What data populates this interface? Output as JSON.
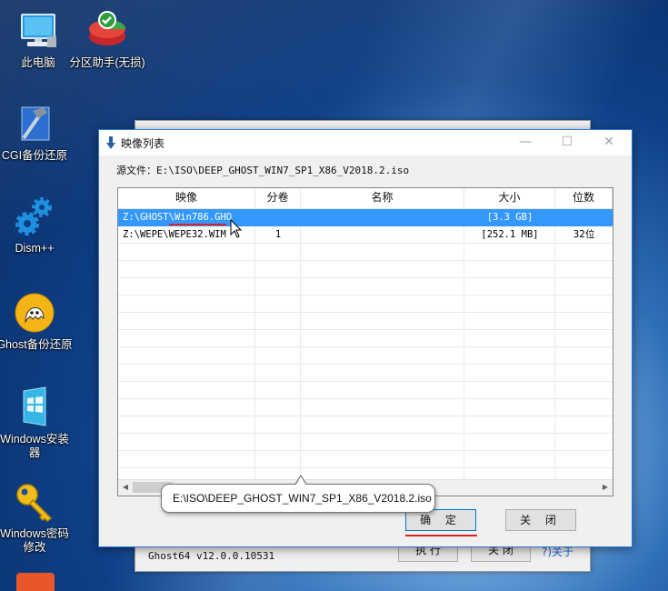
{
  "desktop": {
    "icons": [
      {
        "label": "此电脑"
      },
      {
        "label": "分区助手(无损)"
      },
      {
        "label": "CGI备份还原"
      },
      {
        "label": "Dism++"
      },
      {
        "label": "Ghost备份还原"
      },
      {
        "label": "Windows安装器"
      },
      {
        "label": "Windows密码修改"
      }
    ]
  },
  "back_window": {
    "status_text": "Ghost64 v12.0.0.10531",
    "execute_label": "执 行",
    "close_label": "关 闭",
    "about_label": "?)关于"
  },
  "dialog": {
    "title": "映像列表",
    "source_file": "源文件：E:\\ISO\\DEEP_GHOST_WIN7_SP1_X86_V2018.2.iso",
    "columns": [
      "映像",
      "分卷",
      "名称",
      "大小",
      "位数"
    ],
    "rows": [
      {
        "image": "Z:\\GHOST\\Win786.GHO",
        "volume": "",
        "name": "",
        "size": "[3.3 GB]",
        "bits": "",
        "selected": true
      },
      {
        "image": "Z:\\WEPE\\WEPE32.WIM",
        "volume": "1",
        "name": "",
        "size": "[252.1 MB]",
        "bits": "32位",
        "selected": false
      }
    ],
    "ok_label": "确 定",
    "close_label": "关 闭",
    "tooltip": "E:\\ISO\\DEEP_GHOST_WIN7_SP1_X86_V2018.2.iso"
  },
  "colors": {
    "selection": "#3399ff",
    "accent": "#0078d7",
    "annotation_red": "#e02020"
  }
}
